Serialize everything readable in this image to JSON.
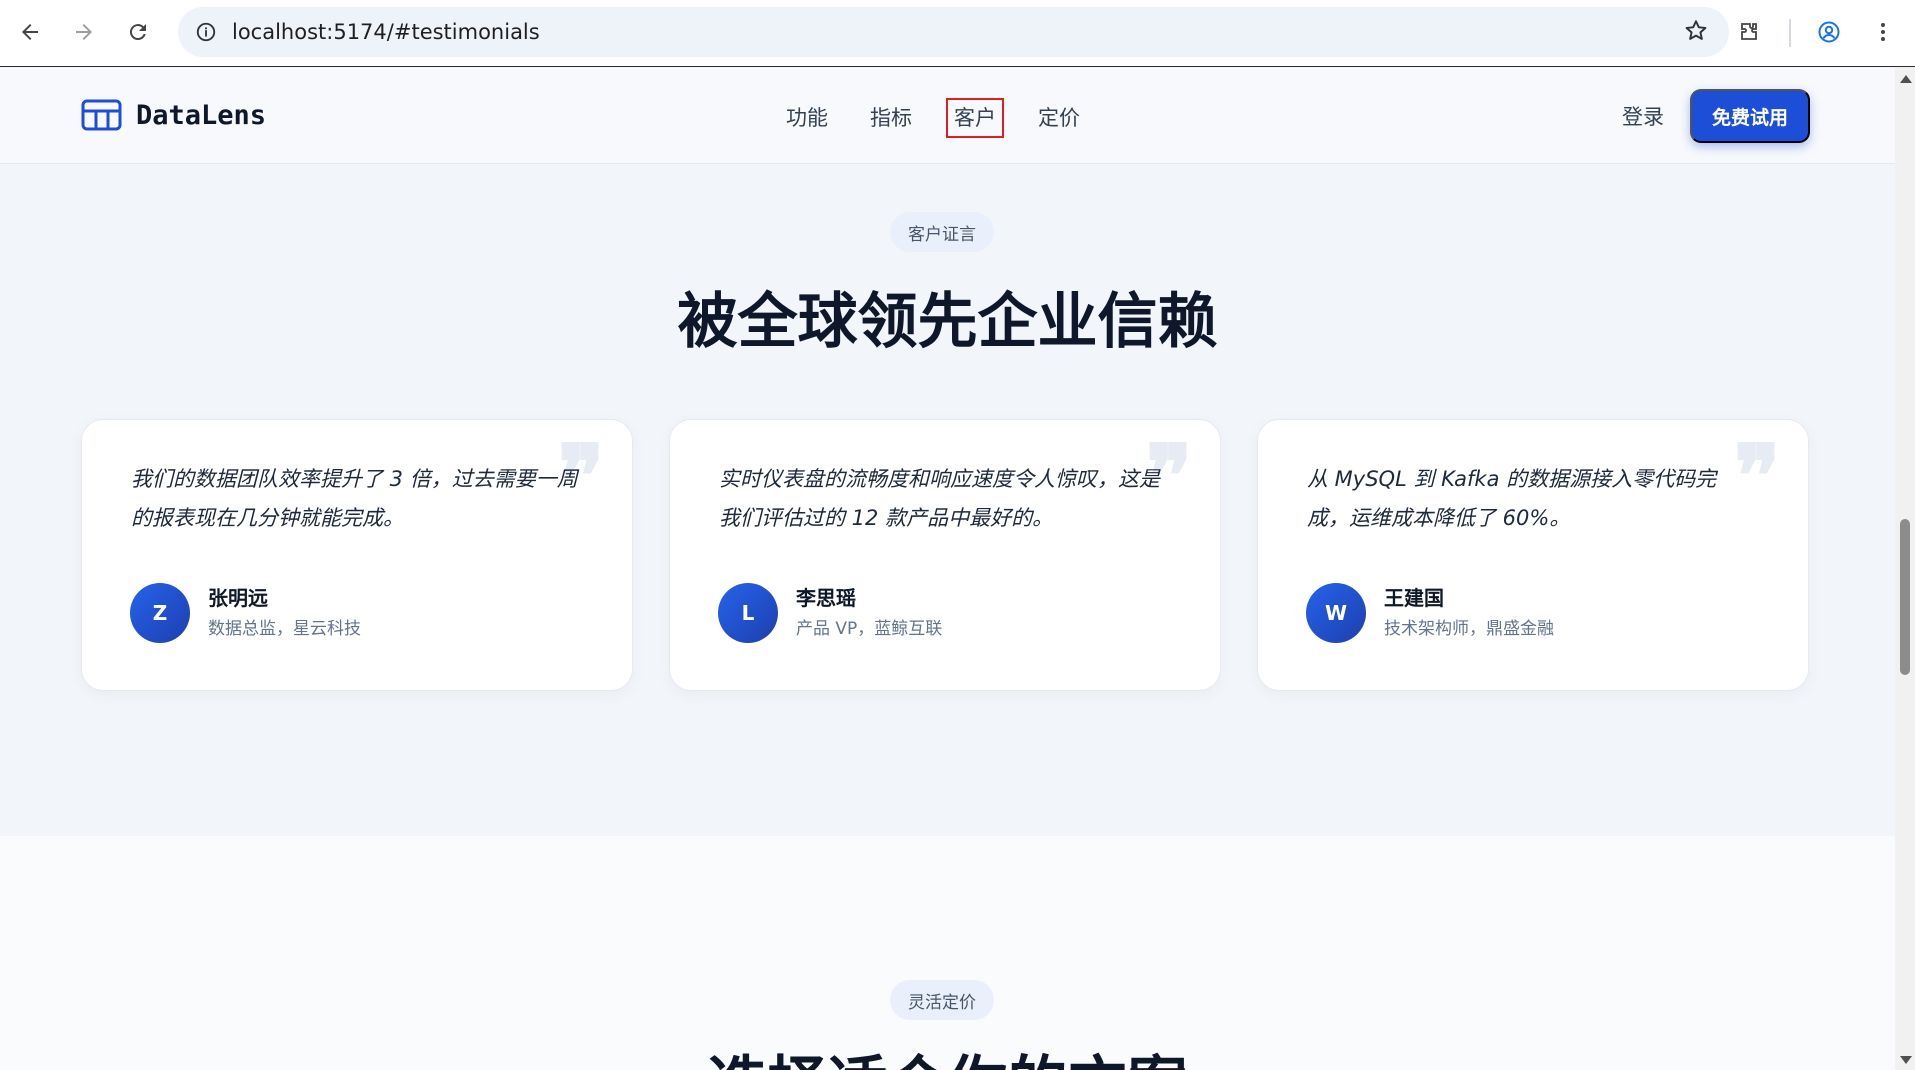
{
  "browser": {
    "url": "localhost:5174/#testimonials",
    "icons": [
      "back-arrow-icon",
      "forward-arrow-icon",
      "reload-icon",
      "site-info-icon",
      "bookmark-star-icon",
      "extensions-icon",
      "profile-icon",
      "more-menu-icon"
    ]
  },
  "header": {
    "brand": "DataLens",
    "nav": [
      "功能",
      "指标",
      "客户",
      "定价"
    ],
    "active_nav": "客户",
    "login": "登录",
    "cta": "免费试用"
  },
  "testimonials": {
    "eyebrow": "客户证言",
    "title": "被全球领先企业信赖",
    "quote_mark": "❞",
    "items": [
      {
        "quote": "我们的数据团队效率提升了 3 倍，过去需要一周的报表现在几分钟就能完成。",
        "initial": "Z",
        "name": "张明远",
        "role": "数据总监，星云科技"
      },
      {
        "quote": "实时仪表盘的流畅度和响应速度令人惊叹，这是我们评估过的 12 款产品中最好的。",
        "initial": "L",
        "name": "李思瑶",
        "role": "产品 VP，蓝鲸互联"
      },
      {
        "quote": "从 MySQL 到 Kafka 的数据源接入零代码完成，运维成本降低了 60%。",
        "initial": "W",
        "name": "王建国",
        "role": "技术架构师，鼎盛金融"
      }
    ]
  },
  "pricing": {
    "eyebrow": "灵活定价",
    "title": "选择适合你的方案"
  },
  "colors": {
    "accent": "#1d4ed8",
    "active_outline": "#e11d24",
    "page_bg": "#f2f5fa"
  }
}
